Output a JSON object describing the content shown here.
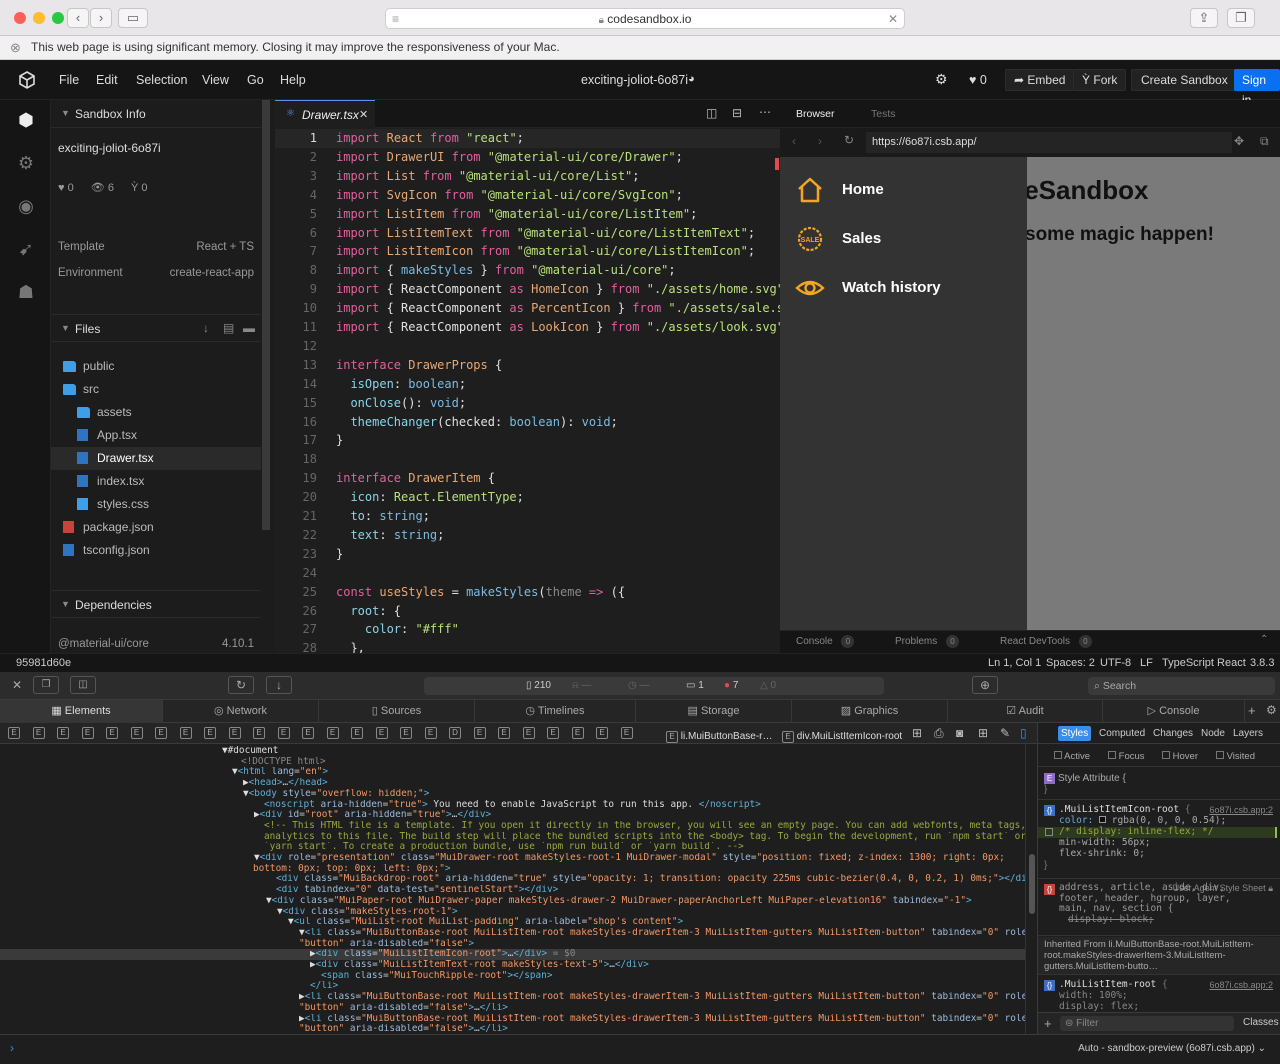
{
  "browser": {
    "url": "codesandbox.io",
    "memory_warning": "This web page is using significant memory. Closing it may improve the responsiveness of your Mac."
  },
  "header": {
    "menu": [
      "File",
      "Edit",
      "Selection",
      "View",
      "Go",
      "Help"
    ],
    "sandbox_name": "exciting-joliot-6o87i",
    "like_count": "0",
    "embed_label": "Embed",
    "fork_label": "Fork",
    "create_label": "Create Sandbox",
    "signin_label": "Sign in"
  },
  "sidebar": {
    "section_info": "Sandbox Info",
    "sandbox_title": "exciting-joliot-6o87i",
    "stats": {
      "likes": "0",
      "views": "6",
      "forks": "0"
    },
    "template_label": "Template",
    "template_value": "React + TS",
    "environment_label": "Environment",
    "environment_value": "create-react-app",
    "files_label": "Files",
    "files": [
      {
        "name": "public",
        "type": "folder",
        "depth": 0
      },
      {
        "name": "src",
        "type": "folder-open",
        "depth": 0
      },
      {
        "name": "assets",
        "type": "folder",
        "depth": 1
      },
      {
        "name": "App.tsx",
        "type": "tsx",
        "depth": 1
      },
      {
        "name": "Drawer.tsx",
        "type": "tsx",
        "depth": 1,
        "active": true
      },
      {
        "name": "index.tsx",
        "type": "tsx",
        "depth": 1
      },
      {
        "name": "styles.css",
        "type": "css",
        "depth": 1
      },
      {
        "name": "package.json",
        "type": "json",
        "depth": 0
      },
      {
        "name": "tsconfig.json",
        "type": "tsx",
        "depth": 0
      }
    ],
    "dependencies_label": "Dependencies",
    "dependency_name": "@material-ui/core",
    "dependency_version": "4.10.1"
  },
  "editor": {
    "tab_name": "Drawer.tsx",
    "line_numbers": [
      "1",
      "2",
      "3",
      "4",
      "5",
      "6",
      "7",
      "8",
      "9",
      "10",
      "11",
      "12",
      "13",
      "14",
      "15",
      "16",
      "17",
      "18",
      "19",
      "20",
      "21",
      "22",
      "23",
      "24",
      "25",
      "26",
      "27",
      "28"
    ]
  },
  "preview": {
    "tab_browser": "Browser",
    "tab_tests": "Tests",
    "address": "https://6o87i.csb.app/",
    "heading_fragment": "leSandbox",
    "subheading_fragment": "some magic happen!",
    "drawer_items": [
      {
        "label": "Home",
        "icon": "home-icon"
      },
      {
        "label": "Sales",
        "icon": "sale-icon"
      },
      {
        "label": "Watch history",
        "icon": "eye-icon"
      }
    ],
    "footer_tabs": [
      {
        "label": "Console",
        "count": "0"
      },
      {
        "label": "Problems",
        "count": "0"
      },
      {
        "label": "React DevTools",
        "count": "0"
      }
    ]
  },
  "status_bar": {
    "commit": "95981d60e",
    "position": "Ln 1, Col 1",
    "spaces": "Spaces: 2",
    "encoding": "UTF-8",
    "eol": "LF",
    "language": "TypeScript React",
    "version": "3.8.3"
  },
  "devtools": {
    "resources_count": "210",
    "logs_count": "1",
    "errors_count": "7",
    "warnings_count": "0",
    "search_placeholder": "Search",
    "tabs": [
      "Elements",
      "Network",
      "Sources",
      "Timelines",
      "Storage",
      "Graphics",
      "Audit",
      "Console"
    ],
    "crumb_last_1": "li.MuiButtonBase-r…",
    "crumb_last_2": "div.MuiListItemIcon-root",
    "styles_tabs": [
      "Styles",
      "Computed",
      "Changes",
      "Node",
      "Layers"
    ],
    "pseudo": [
      "Active",
      "Focus",
      "Hover",
      "Visited"
    ],
    "style_attribute": "Style Attribute",
    "rule1_selector": ".MuiListItemIcon-root",
    "rule1_source": "6o87i.csb.app:2",
    "rule1_props": [
      "color: rgba(0, 0, 0, 0.54);",
      "/* display: inline-flex; */",
      "min-width: 56px;",
      "flex-shrink: 0;"
    ],
    "ua_label": "User Agent Style Sheet",
    "ua_selector": "address, article, aside, div, footer, header, hgroup, layer, main, nav, section {",
    "ua_prop": "display: block;",
    "inherited": "Inherited From li.MuiButtonBase-root.MuiListItem-root.makeStyles-drawerItem-3.MuiListItem-gutters.MuiListItem-butto…",
    "rule2_selector": ".MuiListItem-root",
    "rule2_source": "6o87i.csb.app:2",
    "rule2_props": [
      "width: 100%;",
      "display: flex;"
    ],
    "filter_placeholder": "Filter",
    "classes_label": "Classes",
    "console_context": "Auto - sandbox-preview (6o87i.csb.app)"
  }
}
